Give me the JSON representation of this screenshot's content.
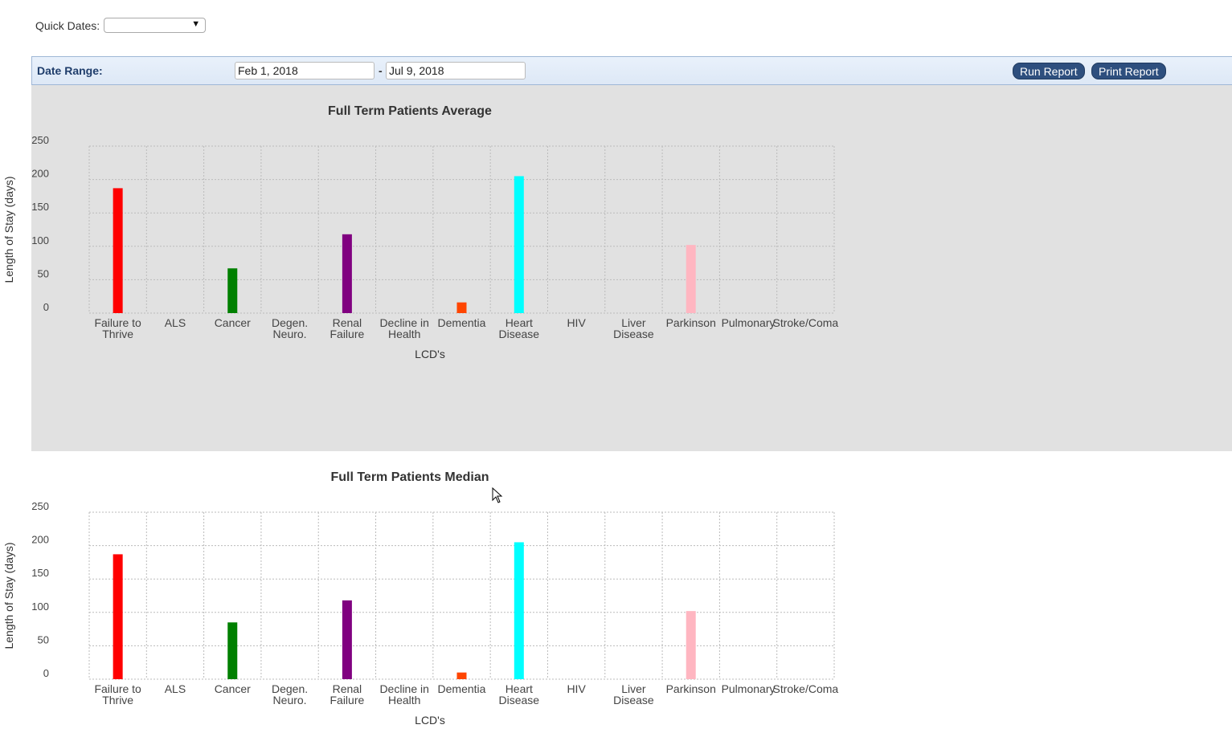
{
  "quick_dates": {
    "label": "Quick Dates:",
    "value": ""
  },
  "toolbar": {
    "date_range_label": "Date Range:",
    "start_date": "Feb 1, 2018",
    "separator": "-",
    "end_date": "Jul 9, 2018",
    "run_label": "Run Report",
    "print_label": "Print Report",
    "button_color": "#2e4f7e"
  },
  "chart_data": [
    {
      "type": "bar",
      "title": "Full Term Patients Average",
      "xlabel": "LCD's",
      "ylabel": "Length of Stay (days)",
      "ylim": [
        0,
        250
      ],
      "yticks": [
        0,
        50,
        100,
        150,
        200,
        250
      ],
      "grid": true,
      "categories": [
        "Failure to Thrive",
        "ALS",
        "Cancer",
        "Degen. Neuro.",
        "Renal Failure",
        "Decline in Health",
        "Dementia",
        "Heart Disease",
        "HIV",
        "Liver Disease",
        "Parkinson",
        "Pulmonary",
        "Stroke/Coma"
      ],
      "category_lines": [
        [
          "Failure to",
          "Thrive"
        ],
        [
          "ALS"
        ],
        [
          "Cancer"
        ],
        [
          "Degen.",
          "Neuro."
        ],
        [
          "Renal",
          "Failure"
        ],
        [
          "Decline in",
          "Health"
        ],
        [
          "Dementia"
        ],
        [
          "Heart",
          "Disease"
        ],
        [
          "HIV"
        ],
        [
          "Liver",
          "Disease"
        ],
        [
          "Parkinson"
        ],
        [
          "Pulmonary"
        ],
        [
          "Stroke/Coma"
        ]
      ],
      "values": [
        187,
        0,
        67,
        0,
        118,
        0,
        16,
        205,
        0,
        0,
        102,
        0,
        0
      ],
      "colors": [
        "#ff0000",
        "#ff0000",
        "#008000",
        "#008000",
        "#800080",
        "#800080",
        "#ff4500",
        "#00ffff",
        "#00ffff",
        "#00ffff",
        "#ffb6c1",
        "#ffb6c1",
        "#ffb6c1"
      ]
    },
    {
      "type": "bar",
      "title": "Full Term Patients Median",
      "xlabel": "LCD's",
      "ylabel": "Length of Stay (days)",
      "ylim": [
        0,
        250
      ],
      "yticks": [
        0,
        50,
        100,
        150,
        200,
        250
      ],
      "grid": true,
      "categories": [
        "Failure to Thrive",
        "ALS",
        "Cancer",
        "Degen. Neuro.",
        "Renal Failure",
        "Decline in Health",
        "Dementia",
        "Heart Disease",
        "HIV",
        "Liver Disease",
        "Parkinson",
        "Pulmonary",
        "Stroke/Coma"
      ],
      "category_lines": [
        [
          "Failure to",
          "Thrive"
        ],
        [
          "ALS"
        ],
        [
          "Cancer"
        ],
        [
          "Degen.",
          "Neuro."
        ],
        [
          "Renal",
          "Failure"
        ],
        [
          "Decline in",
          "Health"
        ],
        [
          "Dementia"
        ],
        [
          "Heart",
          "Disease"
        ],
        [
          "HIV"
        ],
        [
          "Liver",
          "Disease"
        ],
        [
          "Parkinson"
        ],
        [
          "Pulmonary"
        ],
        [
          "Stroke/Coma"
        ]
      ],
      "values": [
        187,
        0,
        85,
        0,
        118,
        0,
        10,
        205,
        0,
        0,
        102,
        0,
        0
      ],
      "colors": [
        "#ff0000",
        "#ff0000",
        "#008000",
        "#008000",
        "#800080",
        "#800080",
        "#ff4500",
        "#00ffff",
        "#00ffff",
        "#00ffff",
        "#ffb6c1",
        "#ffb6c1",
        "#ffb6c1"
      ]
    }
  ]
}
